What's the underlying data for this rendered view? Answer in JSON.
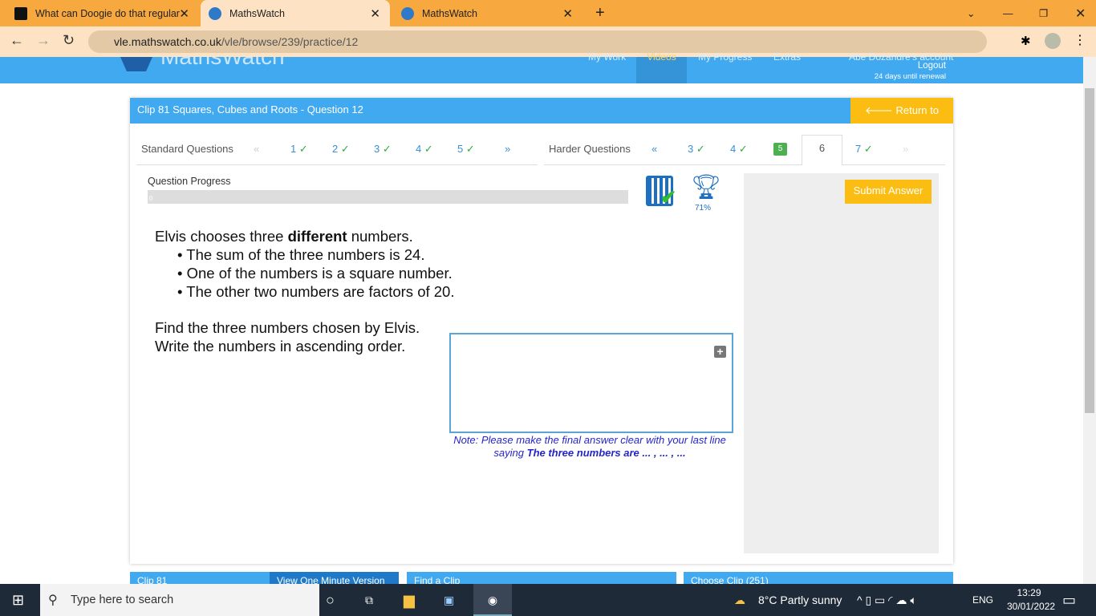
{
  "browser": {
    "tabs": [
      {
        "label": "What can Doogie do that regular"
      },
      {
        "label": "MathsWatch"
      },
      {
        "label": "MathsWatch"
      }
    ],
    "url_host": "vle.mathswatch.co.uk",
    "url_path": "/vle/browse/239/practice/12"
  },
  "site": {
    "logo": "MathsWatch",
    "nav": [
      "My Work",
      "Videos",
      "My Progress",
      "Extras"
    ],
    "account": "Abe Dozandre's account",
    "logout": "Logout",
    "renewal": "24 days until renewal"
  },
  "card": {
    "title": "Clip 81 Squares, Cubes and Roots - Question 12",
    "return": "Return to Videos",
    "standard_label": "Standard Questions",
    "standard": [
      {
        "n": "1",
        "done": true
      },
      {
        "n": "2",
        "done": true
      },
      {
        "n": "3",
        "done": true
      },
      {
        "n": "4",
        "done": true
      },
      {
        "n": "5",
        "done": true
      }
    ],
    "harder_label": "Harder Questions",
    "harder": [
      {
        "n": "3",
        "done": true
      },
      {
        "n": "4",
        "done": true
      },
      {
        "n": "5"
      },
      {
        "n": "6"
      },
      {
        "n": "7",
        "done": true
      }
    ],
    "check": "✓",
    "prev": "«",
    "next": "»",
    "progress_label": "Question Progress",
    "progress_value": "0",
    "progress_fraction": 0,
    "trophy_pct": "71%",
    "submit": "Submit Answer",
    "question": {
      "intro_a": "Elvis chooses three ",
      "intro_bold": "different",
      "intro_b": " numbers.",
      "bullets": [
        "• The sum of the three numbers is 24.",
        "• One of the numbers is a square number.",
        "• The other two numbers are factors of 20."
      ],
      "find": "Find the three numbers chosen by Elvis.",
      "write": "Write the numbers in ascending order."
    },
    "note_a": "Note: Please make the final answer clear with your last line saying ",
    "note_bold": "The three numbers are ... , ... , ..."
  },
  "bottom": {
    "clip": "Clip 81",
    "one_min": "View One Minute Version",
    "find": "Find a Clip",
    "choose": "Choose Clip (251)"
  },
  "taskbar": {
    "search": "Type here to search",
    "weather": "8°C  Partly sunny",
    "lang": "ENG",
    "time": "13:29",
    "date": "30/01/2022"
  }
}
